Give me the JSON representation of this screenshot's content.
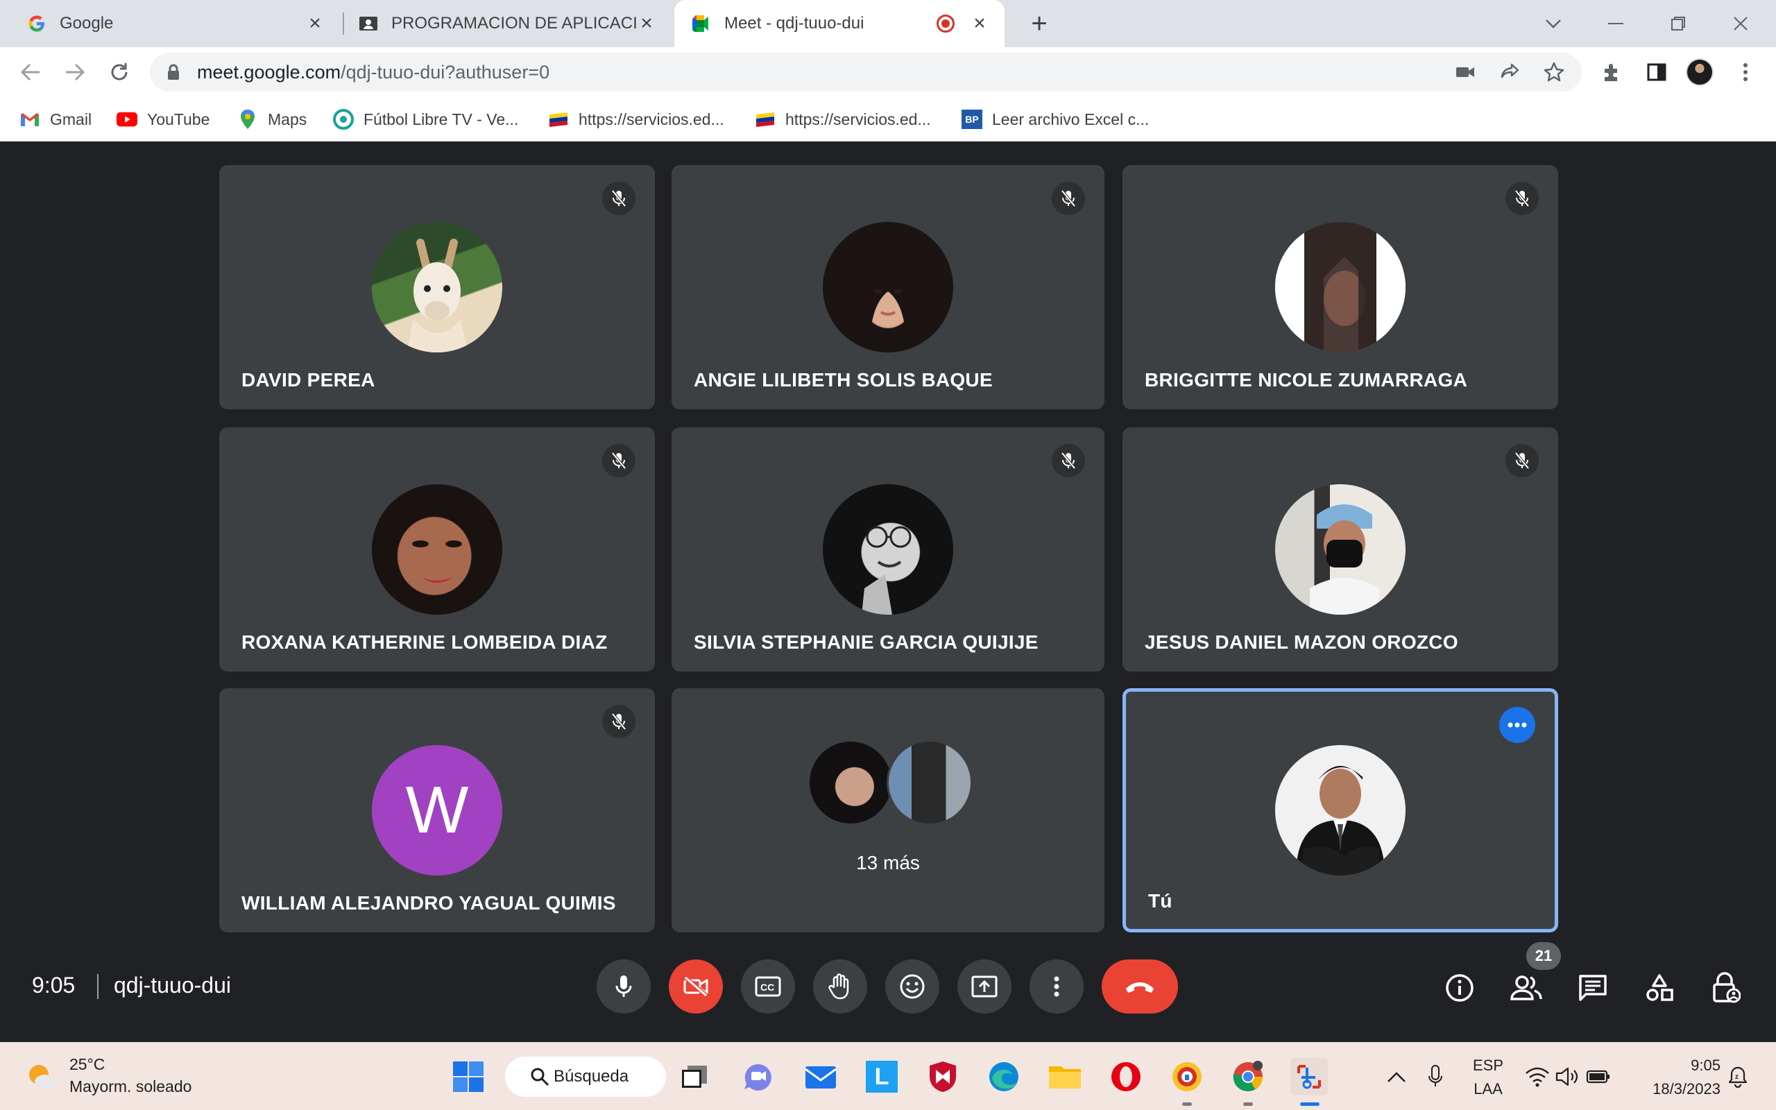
{
  "browser": {
    "tabs": [
      {
        "title": "Google",
        "favicon": "google-icon",
        "active": false
      },
      {
        "title": "PROGRAMACION DE APLICACIONES",
        "favicon": "classroom-icon",
        "active": false
      },
      {
        "title": "Meet - qdj-tuuo-dui",
        "favicon": "meet-icon",
        "active": true,
        "recording": true
      }
    ],
    "url_host": "meet.google.com",
    "url_path": "/qdj-tuuo-dui?authuser=0",
    "bookmarks": [
      {
        "label": "Gmail",
        "icon": "gmail-icon"
      },
      {
        "label": "YouTube",
        "icon": "youtube-icon"
      },
      {
        "label": "Maps",
        "icon": "maps-icon"
      },
      {
        "label": "Fútbol Libre TV - Ve...",
        "icon": "futbol-icon"
      },
      {
        "label": "https://servicios.ed...",
        "icon": "ecuador-flag-icon"
      },
      {
        "label": "https://servicios.ed...",
        "icon": "ecuador-flag-icon"
      },
      {
        "label": "Leer archivo Excel c...",
        "icon": "bp-icon"
      }
    ]
  },
  "meet": {
    "participants": [
      {
        "name": "DAVID PEREA",
        "muted": true,
        "avatar": "llama-illustration"
      },
      {
        "name": "ANGIE LILIBETH SOLIS BAQUE",
        "muted": true,
        "avatar": "photo"
      },
      {
        "name": "BRIGGITTE NICOLE ZUMARRAGA",
        "muted": true,
        "avatar": "photo"
      },
      {
        "name": "ROXANA KATHERINE LOMBEIDA DIAZ",
        "muted": true,
        "avatar": "photo"
      },
      {
        "name": "SILVIA STEPHANIE GARCIA QUIJIJE",
        "muted": true,
        "avatar": "bw-photo"
      },
      {
        "name": "JESUS DANIEL MAZON OROZCO",
        "muted": true,
        "avatar": "photo"
      },
      {
        "name": "WILLIAM ALEJANDRO YAGUAL QUIMIS",
        "muted": true,
        "avatar": "W",
        "avatar_color": "#a142c2"
      }
    ],
    "more_label": "13 más",
    "self_label": "Tú",
    "time": "9:05",
    "meeting_code": "qdj-tuuo-dui",
    "participant_count": "21",
    "colors": {
      "hangup": "#ea4335",
      "self_border": "#8ab4f8",
      "tile": "#3c4043",
      "background": "#202124"
    }
  },
  "taskbar": {
    "weather_temp": "25°C",
    "weather_desc": "Mayorm. soleado",
    "search_label": "Búsqueda",
    "lang_top": "ESP",
    "lang_bottom": "LAA",
    "clock_time": "9:05",
    "clock_date": "18/3/2023"
  }
}
